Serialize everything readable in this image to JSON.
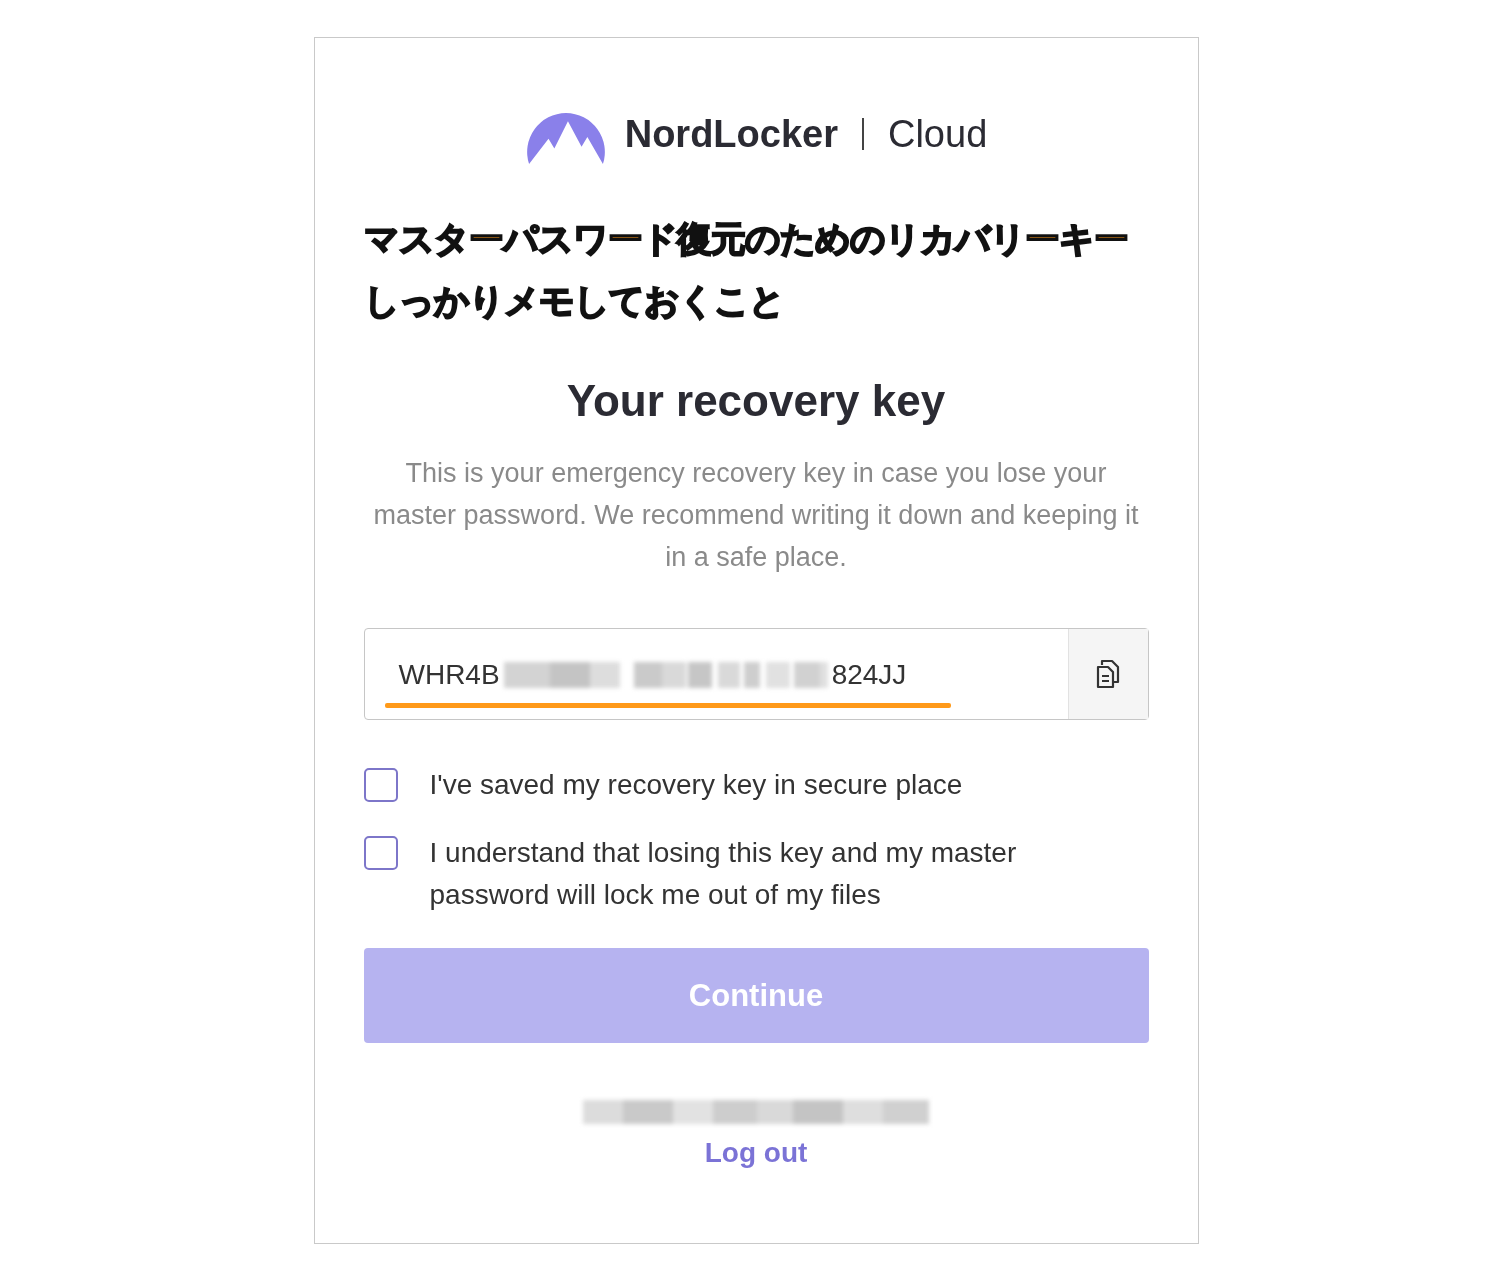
{
  "brand": {
    "name": "NordLocker",
    "product": "Cloud"
  },
  "annotation": [
    "マスターパスワード復元のためのリカバリーキー",
    "しっかりメモしておくこと"
  ],
  "title": "Your recovery key",
  "description": "This is your emergency recovery key in case you lose your master password. We recommend writing it down and keeping it in a safe place.",
  "recovery_key": {
    "start": "WHR4B",
    "end": "824JJ"
  },
  "checkboxes": [
    {
      "label": "I've saved my recovery key in secure place",
      "checked": false
    },
    {
      "label": "I understand that losing this key and my master password will lock me out of my files",
      "checked": false
    }
  ],
  "continue_button": {
    "label": "Continue",
    "disabled": true
  },
  "logout_link": "Log out"
}
